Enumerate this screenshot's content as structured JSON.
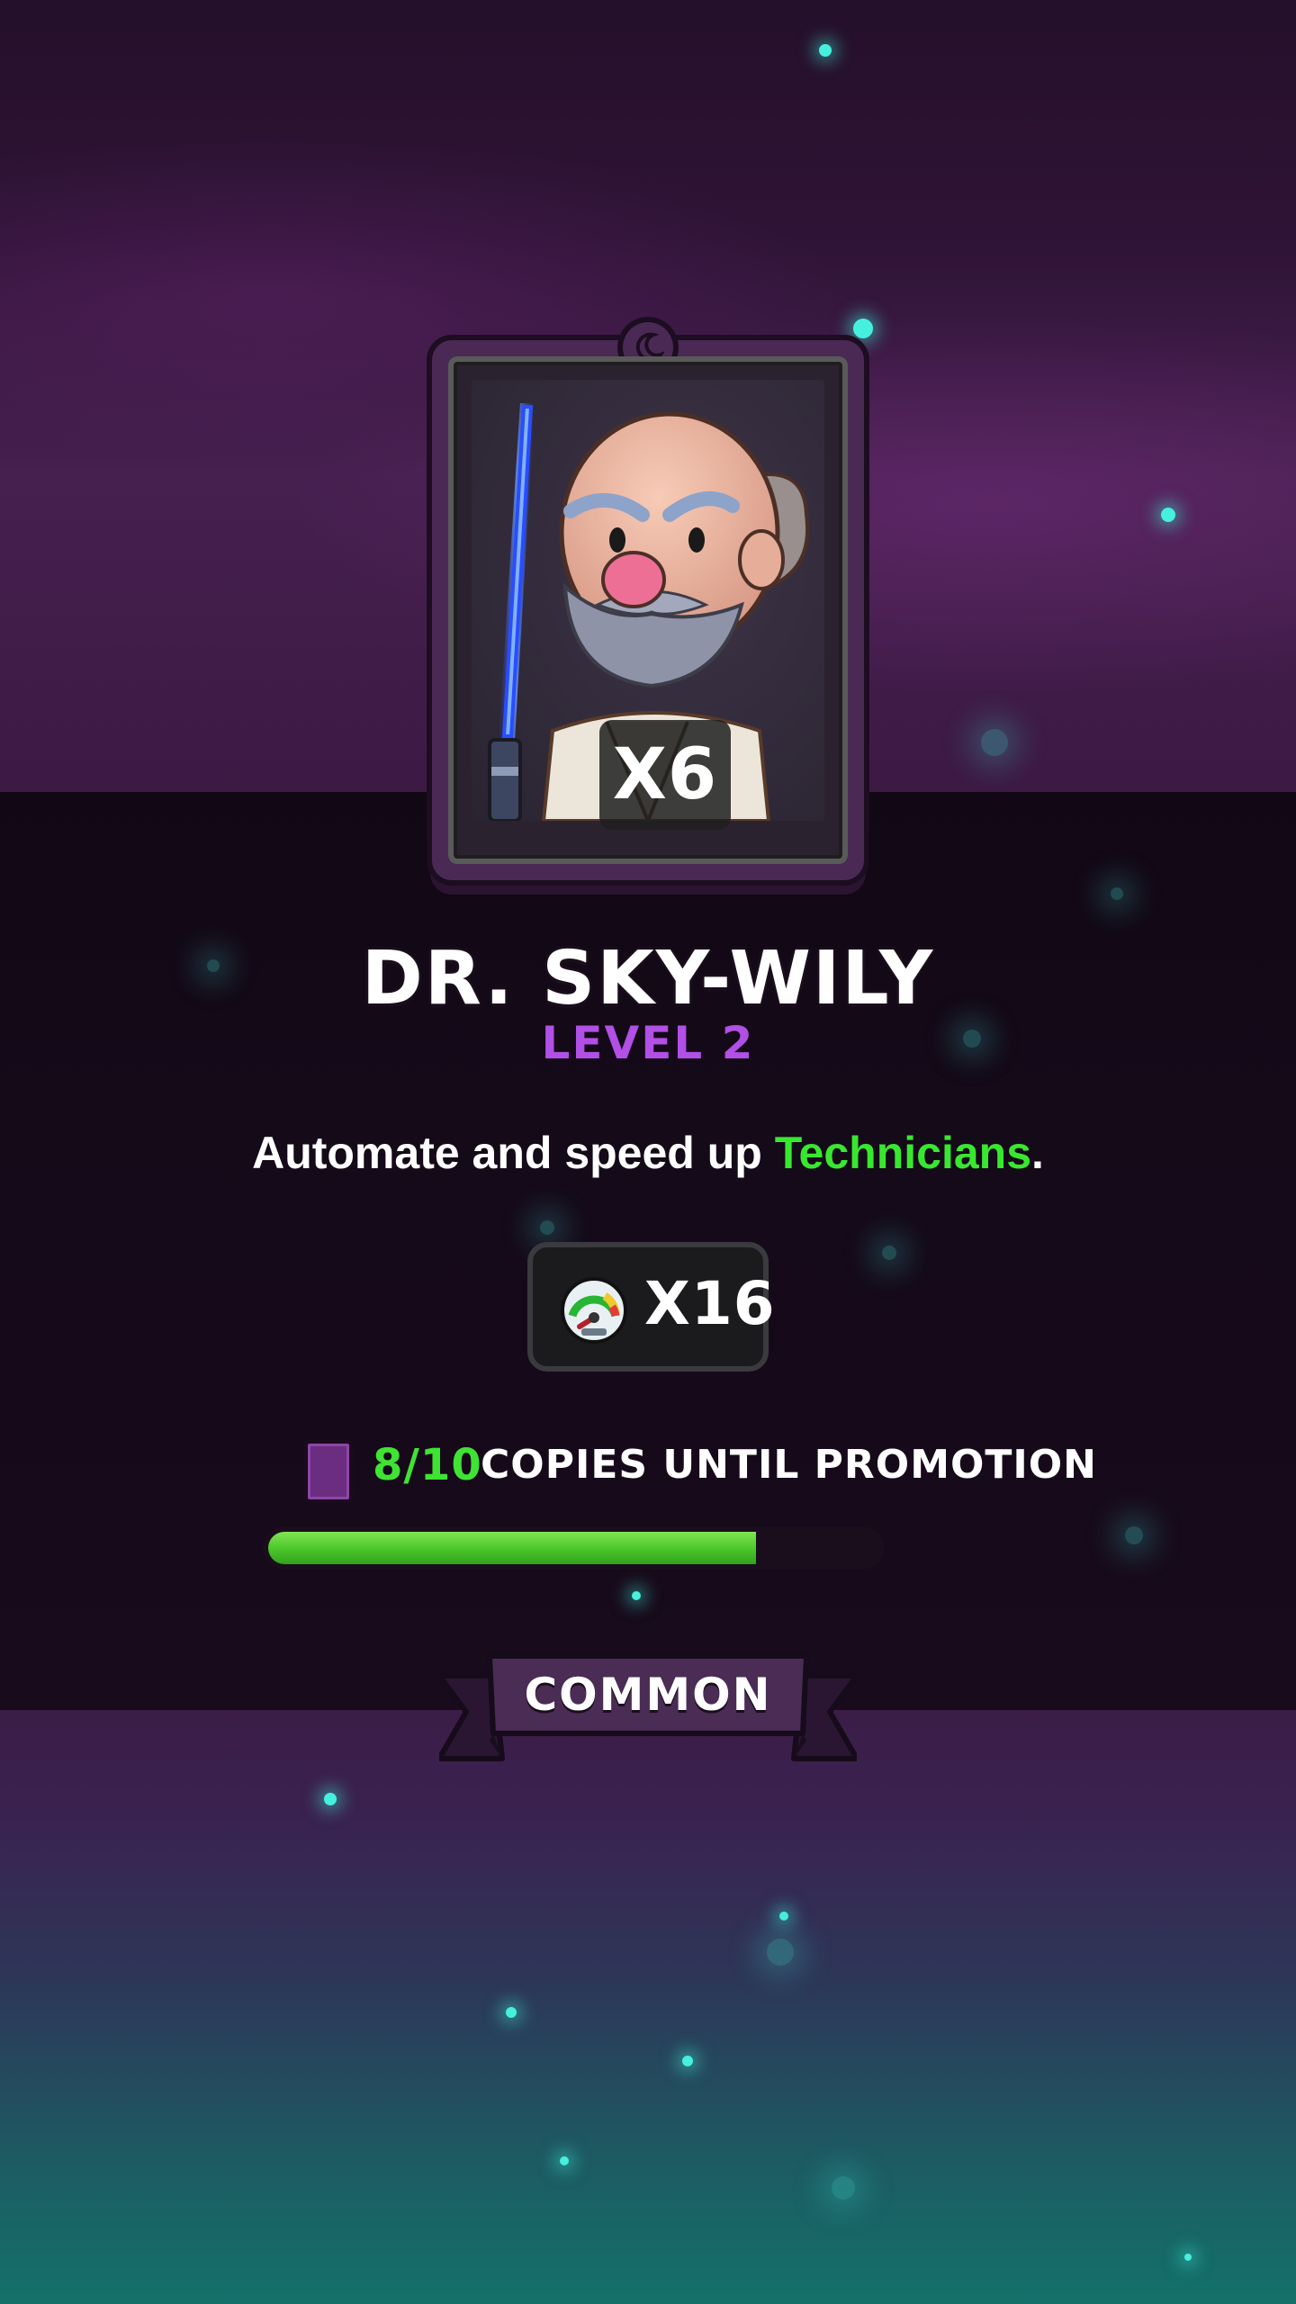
{
  "card": {
    "copies_label": "X6",
    "character_image": "bearded-sage-with-blue-lightsaber",
    "frame_color": "#4a2a55",
    "emblem_icon": "crescent-moon-icon"
  },
  "character": {
    "name": "DR. SKY-WILY",
    "level": "LEVEL 2"
  },
  "description": {
    "prefix": "Automate and speed up ",
    "highlight": "Technicians",
    "suffix": ".",
    "highlight_color": "#38e82f"
  },
  "boost": {
    "icon": "speedometer-icon",
    "value": "X16"
  },
  "promotion": {
    "icon": "card-icon",
    "count": "8/10",
    "label": "COPIES UNTIL PROMOTION",
    "progress": 0.8
  },
  "rarity": {
    "label": "COMMON"
  },
  "colors": {
    "level_purple": "#b24fe6",
    "progress_green": "#4ac52a",
    "particle_cyan": "#46f0de"
  }
}
